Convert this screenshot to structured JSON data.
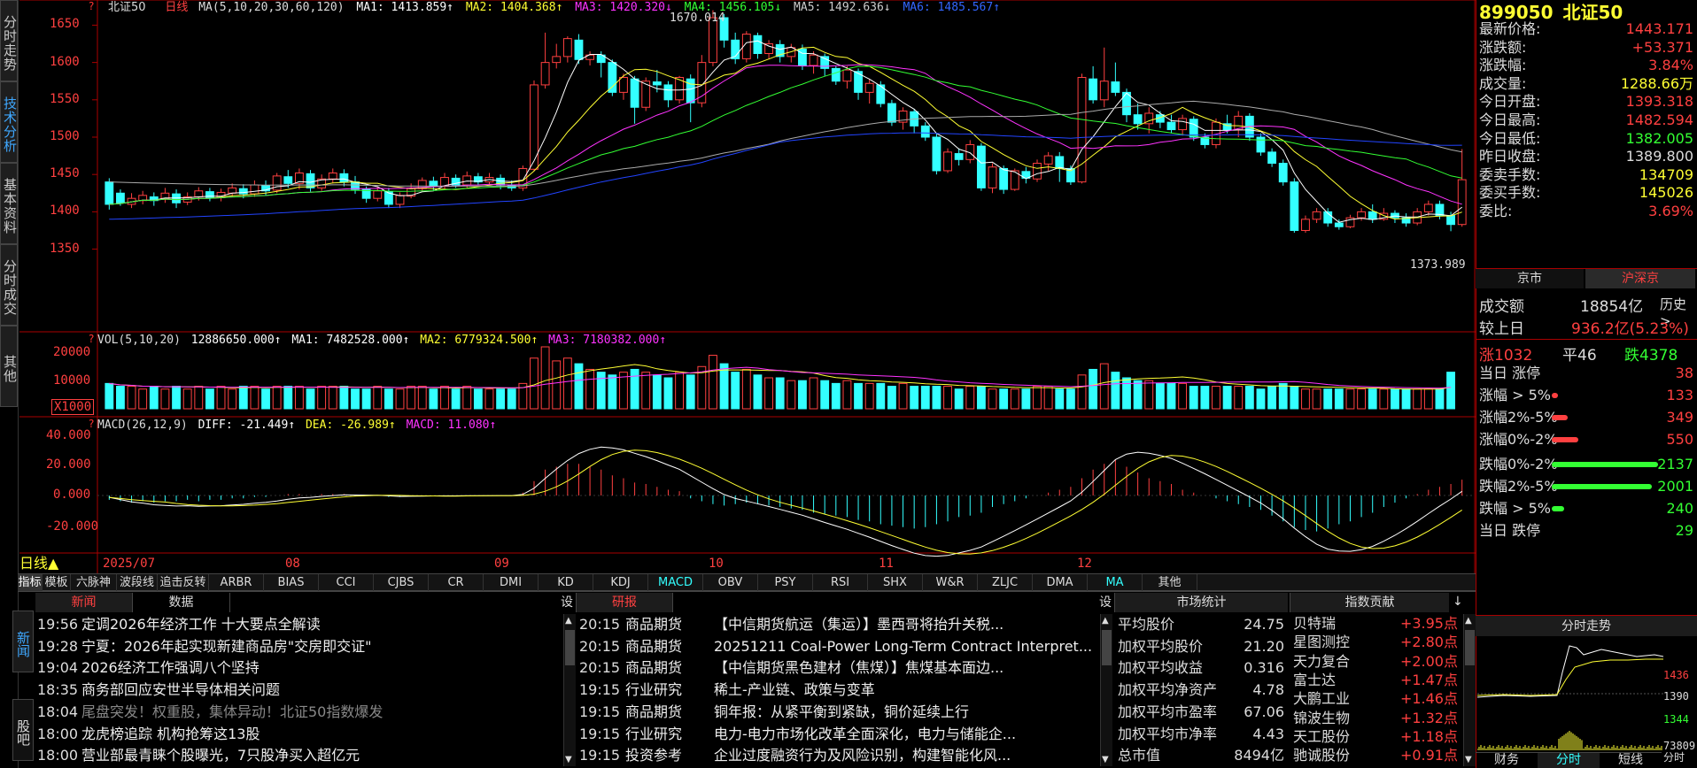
{
  "side_tabs": [
    "分时走势",
    "技术分析",
    "基本资料",
    "分时成交",
    "其他"
  ],
  "chart_header": {
    "name": "北证50",
    "period": "日线",
    "ma_label": "MA(5,10,20,30,60,120)",
    "ma1": "MA1: 1413.859↑",
    "ma2": "MA2: 1404.368↑",
    "ma3": "MA3: 1420.320↓",
    "ma4": "MA4: 1456.105↓",
    "ma5": "MA5: 1492.636↓",
    "ma6": "MA6: 1485.567↑"
  },
  "price_axis": [
    "1650",
    "1600",
    "1550",
    "1500",
    "1450",
    "1400",
    "1350"
  ],
  "price_annotations": {
    "high": "1670.014",
    "low": "1373.989"
  },
  "vol_header": {
    "label": "VOL(5,10,20)",
    "value": "12886650.000↑",
    "ma1": "MA1: 7482528.000↑",
    "ma2": "MA2: 6779324.500↑",
    "ma3": "MA3: 7180382.000↑"
  },
  "vol_axis": [
    "20000",
    "10000"
  ],
  "vol_unit": "X1000",
  "macd_header": {
    "label": "MACD(26,12,9)",
    "diff": "DIFF: -21.449↑",
    "dea": "DEA: -26.989↑",
    "macd": "MACD: 11.080↑"
  },
  "macd_axis": [
    "40.000",
    "20.000",
    "0.000",
    "-20.000"
  ],
  "date_axis": {
    "period": "日线▲",
    "labels": [
      "2025/07",
      "08",
      "09",
      "10",
      "11",
      "12"
    ]
  },
  "indicator_tabs": [
    "指标",
    "模板",
    "六脉神剑",
    "波段线",
    "追击反转",
    "ARBR",
    "BIAS",
    "CCI",
    "CJBS",
    "CR",
    "DMI",
    "KD",
    "KDJ",
    "MACD",
    "OBV",
    "PSY",
    "RSI",
    "SHX",
    "W&R",
    "ZLJC",
    "DMA",
    "MA",
    "其他"
  ],
  "chart_data": {
    "type": "candlestick",
    "title": "北证50",
    "ylim": [
      1330,
      1690
    ],
    "candles": [
      [
        1440,
        1410,
        1445,
        1403
      ],
      [
        1425,
        1412,
        1430,
        1408
      ],
      [
        1410,
        1418,
        1425,
        1405
      ],
      [
        1415,
        1422,
        1428,
        1410
      ],
      [
        1420,
        1415,
        1426,
        1408
      ],
      [
        1418,
        1425,
        1432,
        1412
      ],
      [
        1424,
        1412,
        1430,
        1405
      ],
      [
        1413,
        1420,
        1426,
        1409
      ],
      [
        1420,
        1428,
        1433,
        1415
      ],
      [
        1427,
        1419,
        1432,
        1414
      ],
      [
        1419,
        1426,
        1431,
        1414
      ],
      [
        1425,
        1432,
        1438,
        1420
      ],
      [
        1431,
        1424,
        1437,
        1418
      ],
      [
        1424,
        1436,
        1442,
        1420
      ],
      [
        1435,
        1428,
        1442,
        1422
      ],
      [
        1429,
        1448,
        1452,
        1425
      ],
      [
        1447,
        1438,
        1456,
        1432
      ],
      [
        1438,
        1452,
        1458,
        1430
      ],
      [
        1451,
        1432,
        1456,
        1427
      ],
      [
        1432,
        1444,
        1450,
        1428
      ],
      [
        1444,
        1452,
        1458,
        1438
      ],
      [
        1451,
        1440,
        1457,
        1434
      ],
      [
        1440,
        1430,
        1448,
        1424
      ],
      [
        1430,
        1418,
        1434,
        1412
      ],
      [
        1418,
        1428,
        1433,
        1414
      ],
      [
        1427,
        1410,
        1432,
        1405
      ],
      [
        1410,
        1422,
        1426,
        1405
      ],
      [
        1421,
        1432,
        1438,
        1418
      ],
      [
        1431,
        1442,
        1446,
        1428
      ],
      [
        1441,
        1434,
        1447,
        1429
      ],
      [
        1434,
        1446,
        1452,
        1430
      ],
      [
        1445,
        1436,
        1450,
        1432
      ],
      [
        1436,
        1448,
        1454,
        1432
      ],
      [
        1447,
        1440,
        1452,
        1436
      ],
      [
        1440,
        1446,
        1452,
        1436
      ],
      [
        1445,
        1436,
        1450,
        1430
      ],
      [
        1436,
        1432,
        1442,
        1428
      ],
      [
        1432,
        1458,
        1462,
        1428
      ],
      [
        1457,
        1570,
        1576,
        1455
      ],
      [
        1570,
        1600,
        1640,
        1565
      ],
      [
        1600,
        1608,
        1625,
        1592
      ],
      [
        1608,
        1632,
        1635,
        1600
      ],
      [
        1630,
        1604,
        1638,
        1598
      ],
      [
        1604,
        1610,
        1615,
        1596
      ],
      [
        1610,
        1600,
        1615,
        1580
      ],
      [
        1600,
        1560,
        1604,
        1555
      ],
      [
        1560,
        1580,
        1585,
        1550
      ],
      [
        1578,
        1540,
        1582,
        1518
      ],
      [
        1540,
        1575,
        1580,
        1535
      ],
      [
        1574,
        1570,
        1590,
        1560
      ],
      [
        1570,
        1550,
        1575,
        1540
      ],
      [
        1550,
        1580,
        1582,
        1545
      ],
      [
        1578,
        1546,
        1584,
        1520
      ],
      [
        1546,
        1600,
        1610,
        1540
      ],
      [
        1600,
        1660,
        1670,
        1595
      ],
      [
        1660,
        1630,
        1665,
        1620
      ],
      [
        1630,
        1605,
        1640,
        1598
      ],
      [
        1605,
        1638,
        1642,
        1600
      ],
      [
        1636,
        1612,
        1640,
        1605
      ],
      [
        1612,
        1625,
        1630,
        1605
      ],
      [
        1624,
        1608,
        1630,
        1600
      ],
      [
        1608,
        1620,
        1625,
        1600
      ],
      [
        1618,
        1596,
        1624,
        1590
      ],
      [
        1596,
        1610,
        1615,
        1585
      ],
      [
        1608,
        1592,
        1612,
        1582
      ],
      [
        1592,
        1575,
        1595,
        1570
      ],
      [
        1575,
        1590,
        1595,
        1565
      ],
      [
        1588,
        1560,
        1592,
        1550
      ],
      [
        1560,
        1572,
        1578,
        1545
      ],
      [
        1570,
        1545,
        1575,
        1540
      ],
      [
        1545,
        1520,
        1550,
        1515
      ],
      [
        1520,
        1535,
        1540,
        1510
      ],
      [
        1534,
        1515,
        1538,
        1505
      ],
      [
        1515,
        1500,
        1520,
        1495
      ],
      [
        1500,
        1455,
        1505,
        1450
      ],
      [
        1455,
        1480,
        1485,
        1452
      ],
      [
        1478,
        1470,
        1485,
        1462
      ],
      [
        1470,
        1490,
        1496,
        1465
      ],
      [
        1488,
        1432,
        1492,
        1428
      ],
      [
        1432,
        1460,
        1465,
        1425
      ],
      [
        1458,
        1430,
        1462,
        1424
      ],
      [
        1430,
        1455,
        1458,
        1428
      ],
      [
        1454,
        1445,
        1460,
        1438
      ],
      [
        1444,
        1465,
        1470,
        1440
      ],
      [
        1464,
        1475,
        1480,
        1455
      ],
      [
        1474,
        1458,
        1480,
        1440
      ],
      [
        1458,
        1440,
        1462,
        1436
      ],
      [
        1440,
        1580,
        1585,
        1438
      ],
      [
        1578,
        1550,
        1595,
        1545
      ],
      [
        1550,
        1575,
        1620,
        1540
      ],
      [
        1574,
        1560,
        1600,
        1555
      ],
      [
        1560,
        1530,
        1565,
        1520
      ],
      [
        1530,
        1518,
        1545,
        1510
      ],
      [
        1518,
        1532,
        1540,
        1505
      ],
      [
        1530,
        1520,
        1535,
        1512
      ],
      [
        1520,
        1510,
        1530,
        1505
      ],
      [
        1510,
        1525,
        1530,
        1502
      ],
      [
        1524,
        1500,
        1528,
        1495
      ],
      [
        1500,
        1490,
        1505,
        1485
      ],
      [
        1490,
        1520,
        1525,
        1485
      ],
      [
        1518,
        1510,
        1530,
        1505
      ],
      [
        1510,
        1528,
        1535,
        1500
      ],
      [
        1528,
        1500,
        1532,
        1495
      ],
      [
        1500,
        1480,
        1505,
        1475
      ],
      [
        1480,
        1465,
        1485,
        1460
      ],
      [
        1465,
        1440,
        1470,
        1435
      ],
      [
        1440,
        1375,
        1445,
        1372
      ],
      [
        1375,
        1390,
        1395,
        1372
      ],
      [
        1390,
        1400,
        1405,
        1385
      ],
      [
        1400,
        1385,
        1405,
        1380
      ],
      [
        1385,
        1380,
        1390,
        1376
      ],
      [
        1380,
        1392,
        1396,
        1378
      ],
      [
        1392,
        1400,
        1405,
        1388
      ],
      [
        1400,
        1390,
        1410,
        1385
      ],
      [
        1390,
        1398,
        1405,
        1388
      ],
      [
        1398,
        1392,
        1402,
        1385
      ],
      [
        1392,
        1385,
        1398,
        1380
      ],
      [
        1385,
        1400,
        1405,
        1382
      ],
      [
        1400,
        1410,
        1415,
        1395
      ],
      [
        1410,
        1395,
        1415,
        1390
      ],
      [
        1395,
        1383,
        1400,
        1374
      ],
      [
        1383,
        1443,
        1484,
        1380
      ]
    ],
    "volume": [
      9,
      8,
      8,
      7,
      8,
      7,
      8,
      7,
      8,
      7,
      8,
      7,
      8,
      8,
      7,
      8,
      8,
      8,
      7,
      8,
      8,
      8,
      7,
      7,
      8,
      7,
      7,
      8,
      8,
      7,
      8,
      7,
      8,
      7,
      7,
      7,
      7,
      9,
      18,
      22,
      17,
      18,
      16,
      14,
      13,
      12,
      13,
      14,
      13,
      12,
      11,
      13,
      12,
      15,
      19,
      16,
      13,
      14,
      12,
      11,
      11,
      10,
      10,
      11,
      10,
      9,
      10,
      9,
      9,
      9,
      8,
      9,
      8,
      8,
      8,
      8,
      7,
      8,
      8,
      7,
      7,
      7,
      7,
      8,
      8,
      7,
      7,
      12,
      14,
      16,
      13,
      11,
      10,
      10,
      9,
      9,
      9,
      8,
      8,
      8,
      8,
      8,
      8,
      7,
      8,
      9,
      8,
      7,
      7,
      7,
      7,
      7,
      7,
      7,
      7,
      7,
      7,
      7,
      7,
      7,
      13
    ],
    "macd_hist": [
      -3,
      -4,
      -5,
      -4,
      -5,
      -4,
      -4,
      -3,
      -4,
      -3,
      -3,
      -2,
      -2,
      -1,
      -1,
      0,
      1,
      1,
      0,
      1,
      1,
      1,
      0,
      0,
      0,
      -1,
      -1,
      0,
      0,
      0,
      0,
      0,
      0,
      0,
      0,
      0,
      0,
      2,
      10,
      18,
      20,
      22,
      22,
      20,
      18,
      14,
      12,
      9,
      8,
      6,
      4,
      3,
      -2,
      -4,
      -6,
      -7,
      -6,
      -5,
      -6,
      -7,
      -8,
      -9,
      -10,
      -12,
      -13,
      -14,
      -15,
      -17,
      -18,
      -20,
      -21,
      -22,
      -23,
      -22,
      -20,
      -18,
      -15,
      -14,
      -12,
      -8,
      -6,
      -4,
      -2,
      0,
      2,
      4,
      6,
      12,
      18,
      22,
      25,
      20,
      16,
      12,
      10,
      8,
      4,
      2,
      0,
      -2,
      -4,
      -6,
      -8,
      -10,
      -14,
      -18,
      -22,
      -24,
      -25,
      -23,
      -20,
      -18,
      -15,
      -12,
      -8,
      -5,
      -2,
      1,
      4,
      6,
      8,
      11
    ]
  },
  "quote": {
    "code": "899050",
    "name": "北证50",
    "rows": [
      {
        "label": "最新价格:",
        "value": "1443.171",
        "color": "#ff4040"
      },
      {
        "label": "涨跌额:",
        "value": "+53.371",
        "color": "#ff4040"
      },
      {
        "label": "涨跌幅:",
        "value": "3.84%",
        "color": "#ff4040"
      },
      {
        "label": "成交量:",
        "value": "1288.66万",
        "color": "#ffff33"
      },
      {
        "label": "今日开盘:",
        "value": "1393.318",
        "color": "#ff4040"
      },
      {
        "label": "今日最高:",
        "value": "1482.594",
        "color": "#ff4040"
      },
      {
        "label": "今日最低:",
        "value": "1382.005",
        "color": "#33ff33"
      },
      {
        "label": "昨日收盘:",
        "value": "1389.800",
        "color": "#dddddd"
      },
      {
        "label": "委卖手数:",
        "value": "134709",
        "color": "#ffff33"
      },
      {
        "label": "委买手数:",
        "value": "145026",
        "color": "#ffff33"
      },
      {
        "label": "委比:",
        "value": "3.69%",
        "color": "#ff4040"
      }
    ],
    "market_tabs": [
      "京市",
      "沪深京"
    ],
    "turnover_label": "成交额",
    "turnover": "18854亿",
    "history": "历史>",
    "vs_prev_label": "较上日",
    "vs_prev": "936.2亿(5.23%)",
    "up": "涨1032",
    "flat": "平46",
    "down": "跌4378",
    "breadth": [
      {
        "label": "当日 涨停",
        "value": "38",
        "color": "#ff4040",
        "bar": 0
      },
      {
        "label": "涨幅 > 5%",
        "value": "133",
        "color": "#ff4040",
        "bar": 3
      },
      {
        "label": "涨幅2%-5%",
        "value": "349",
        "color": "#ff4040",
        "bar": 8
      },
      {
        "label": "涨幅0%-2%",
        "value": "550",
        "color": "#ff4040",
        "bar": 13
      },
      {
        "label": "跌幅0%-2%",
        "value": "2137",
        "color": "#33ff33",
        "bar": 52
      },
      {
        "label": "跌幅2%-5%",
        "value": "2001",
        "color": "#33ff33",
        "bar": 49
      },
      {
        "label": "跌幅 > 5%",
        "value": "240",
        "color": "#33ff33",
        "bar": 6
      },
      {
        "label": "当日 跌停",
        "value": "29",
        "color": "#33ff33",
        "bar": 0
      }
    ]
  },
  "news": {
    "side_tabs": [
      "新闻",
      "股吧"
    ],
    "headers": [
      "新闻",
      "数据",
      "设"
    ],
    "items": [
      {
        "time": "19:56",
        "title": "定调2026年经济工作 十大要点全解读",
        "dim": false
      },
      {
        "time": "19:28",
        "title": "宁夏：2026年起实现新建商品房\"交房即交证\"",
        "dim": false
      },
      {
        "time": "19:04",
        "title": "2026经济工作强调八个坚持",
        "dim": false
      },
      {
        "time": "18:35",
        "title": "商务部回应安世半导体相关问题",
        "dim": false
      },
      {
        "time": "18:04",
        "title": "尾盘突发！权重股，集体异动！北证50指数爆发",
        "dim": true
      },
      {
        "time": "18:00",
        "title": "龙虎榜追踪 机构抢筹这13股",
        "dim": false
      },
      {
        "time": "18:00",
        "title": "营业部最青睐个股曝光，7只股净买入超亿元",
        "dim": false
      }
    ]
  },
  "research": {
    "headers": [
      "研报",
      "设"
    ],
    "items": [
      {
        "time": "20:15",
        "cat": "商品期货",
        "title": "【中信期货航运（集运）】墨西哥将抬升关税..."
      },
      {
        "time": "20:15",
        "cat": "商品期货",
        "title": "20251211 Coal-Power Long-Term Contract Interpret..."
      },
      {
        "time": "20:15",
        "cat": "商品期货",
        "title": "【中信期货黑色建材（焦煤）】焦煤基本面边..."
      },
      {
        "time": "19:15",
        "cat": "行业研究",
        "title": "稀土-产业链、政策与变革"
      },
      {
        "time": "19:15",
        "cat": "商品期货",
        "title": "铜年报：从紧平衡到紧缺，铜价延续上行"
      },
      {
        "time": "19:15",
        "cat": "行业研究",
        "title": "电力-电力市场化改革全面深化，电力与储能企..."
      },
      {
        "time": "19:15",
        "cat": "投资参考",
        "title": "企业过度融资行为及风险识别，构建智能化风..."
      }
    ]
  },
  "market_stats": {
    "header": "市场统计",
    "rows": [
      {
        "label": "平均股价",
        "value": "24.75"
      },
      {
        "label": "加权平均股价",
        "value": "21.20"
      },
      {
        "label": "加权平均收益",
        "value": "0.316"
      },
      {
        "label": "加权平均净资产",
        "value": "4.78"
      },
      {
        "label": "加权平均市盈率",
        "value": "67.06"
      },
      {
        "label": "加权平均市净率",
        "value": "4.43"
      },
      {
        "label": "总市值",
        "value": "8494亿"
      }
    ]
  },
  "contrib": {
    "header": "指数贡献",
    "sort": "↓",
    "rows": [
      {
        "name": "贝特瑞",
        "value": "+3.95点"
      },
      {
        "name": "星图测控",
        "value": "+2.80点"
      },
      {
        "name": "天力复合",
        "value": "+2.00点"
      },
      {
        "name": "富士达",
        "value": "+1.47点"
      },
      {
        "name": "大鹏工业",
        "value": "+1.46点"
      },
      {
        "name": "锦波生物",
        "value": "+1.32点"
      },
      {
        "name": "天工股份",
        "value": "+1.18点"
      },
      {
        "name": "驰诚股份",
        "value": "+0.91点"
      }
    ]
  },
  "mini": {
    "header": "分时走势",
    "axis": [
      "1436",
      "1390",
      "1344",
      "73809",
      "分时"
    ],
    "tabs": [
      "财务",
      "分时",
      "短线"
    ],
    "active_tab": "分时"
  }
}
